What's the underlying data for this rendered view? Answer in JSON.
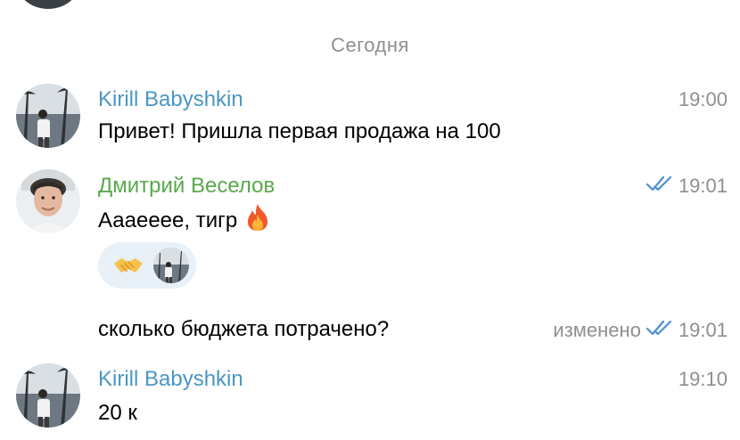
{
  "date_separator": "Сегодня",
  "messages": [
    {
      "sender": "Kirill Babyshkin",
      "time": "19:00",
      "text": "Привет! Пришла первая продажа на 100"
    },
    {
      "sender": "Дмитрий Веселов",
      "time": "19:01",
      "text": "Аааееее, тигр",
      "emoji_icon": "fire-icon",
      "reactions": [
        {
          "icon": "handshake-icon"
        }
      ],
      "read_icon": "double-check-icon"
    },
    {
      "text": "сколько бюджета потрачено?",
      "edited_label": "изменено",
      "time": "19:01",
      "read_icon": "double-check-icon"
    },
    {
      "sender": "Kirill Babyshkin",
      "time": "19:10",
      "text": "20 к"
    }
  ],
  "colors": {
    "sender_kirill": "#4a96c4",
    "sender_dmitry": "#5aa84a",
    "meta_gray": "#8e8e93",
    "check_blue": "#4a8fd4",
    "reaction_bg": "#e8f0f8"
  }
}
